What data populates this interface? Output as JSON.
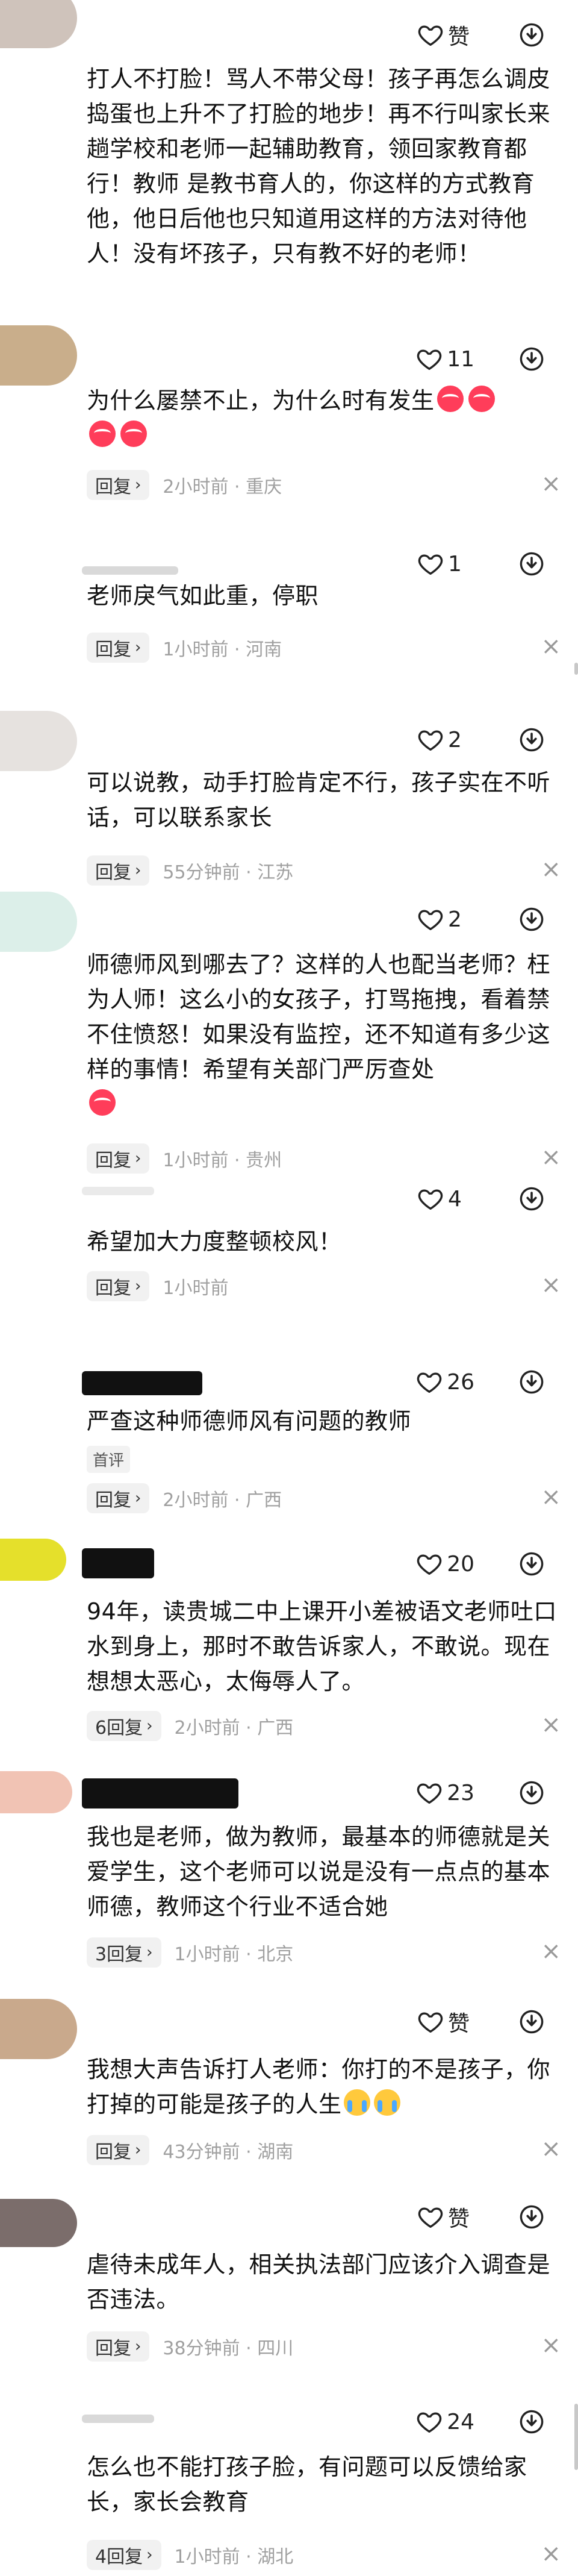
{
  "comments": [
    {
      "likes": "赞",
      "text": "打人不打脸！骂人不带父母！孩子再怎么调皮捣蛋也上升不了打脸的地步！再不行叫家长来趟学校和老师一起辅助教育，领回家教育都行！教师 是教书育人的，你这样的方式教育他，他日后他也只知道用这样的方法对待他人！没有坏孩子，只有教不好的老师！",
      "reply": "",
      "time": ""
    },
    {
      "likes": "11",
      "text": "为什么屡禁不止，为什么时有发生",
      "emoji": [
        "angry-face-emoji",
        "angry-face-emoji",
        "angry-face-emoji",
        "angry-face-emoji"
      ],
      "reply": "回复",
      "time": "2小时前 · 重庆"
    },
    {
      "likes": "1",
      "text": "老师戾气如此重，停职",
      "reply": "回复",
      "time": "1小时前 · 河南"
    },
    {
      "likes": "2",
      "text": "可以说教，动手打脸肯定不行，孩子实在不听话，可以联系家长",
      "reply": "回复",
      "time": "55分钟前 · 江苏"
    },
    {
      "likes": "2",
      "text": "师德师风到哪去了？这样的人也配当老师？枉为人师！这么小的女孩子，打骂拖拽，看着禁不住愤怒！如果没有监控，还不知道有多少这样的事情！希望有关部门严厉查处",
      "reply": "回复",
      "time": "1小时前 · 贵州"
    },
    {
      "likes": "4",
      "text": "希望加大力度整顿校风！",
      "reply": "回复",
      "time": "1小时前"
    },
    {
      "likes": "26",
      "text": "严查这种师德师风有问题的教师",
      "tag": "首评",
      "reply": "回复",
      "time": "2小时前 · 广西"
    },
    {
      "likes": "20",
      "text": "94年，读贵城二中上课开小差被语文老师吐口水到身上，那时不敢告诉家人，不敢说。现在想想太恶心，太侮辱人了。",
      "reply": "6回复",
      "time": "2小时前 · 广西"
    },
    {
      "likes": "23",
      "text": "我也是老师，做为教师，最基本的师德就是关爱学生，这个老师可以说是没有一点点的基本师德，教师这个行业不适合她",
      "reply": "3回复",
      "time": "1小时前 · 北京"
    },
    {
      "likes": "赞",
      "text": "我想大声告诉打人老师：你打的不是孩子，你打掉的可能是孩子的人生",
      "reply": "回复",
      "time": "43分钟前 · 湖南"
    },
    {
      "likes": "赞",
      "text": "虐待未成年人，相关执法部门应该介入调查是否违法。",
      "reply": "回复",
      "time": "38分钟前 · 四川"
    },
    {
      "likes": "24",
      "text": "怎么也不能打孩子脸，有问题可以反馈给家长，家长会教育",
      "reply": "4回复",
      "time": "1小时前 · 湖北"
    }
  ],
  "icons": {
    "like": "heart-outline-icon",
    "dislike": "thumbs-down-outline-icon",
    "chevron": "chevron-right-icon",
    "close": "close-icon"
  },
  "colors": {
    "text": "#111111",
    "meta": "#a0a0a0",
    "reply_bg": "#f1f1f1",
    "emoji_red": "#ff3d5a"
  },
  "glyphs": {
    "chevron": "›",
    "close": "×"
  }
}
